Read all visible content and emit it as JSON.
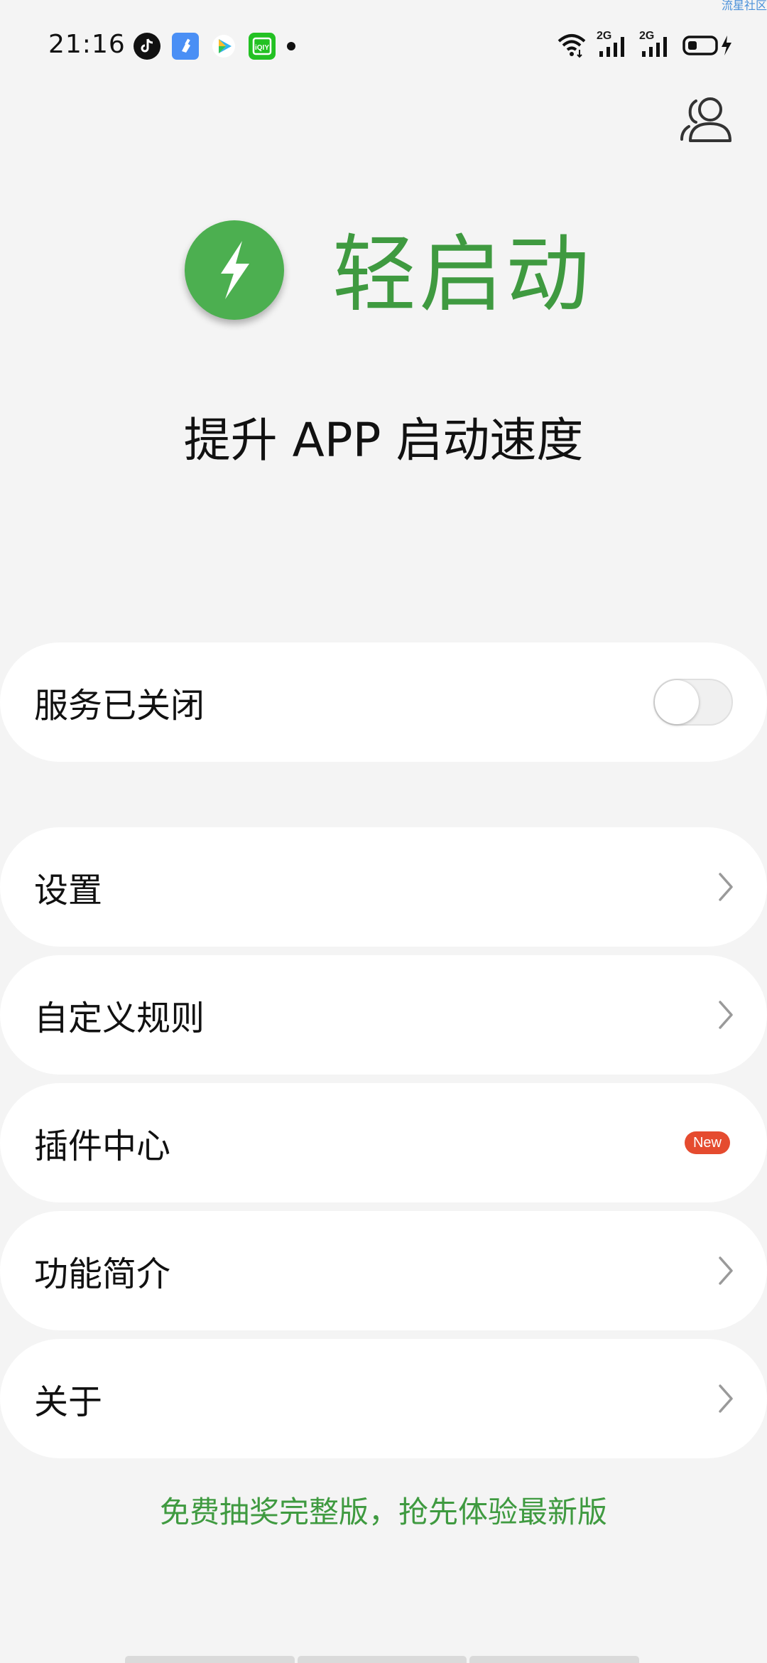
{
  "watermark": "流星社区",
  "status_bar": {
    "time": "21:16",
    "network_1": "2G",
    "network_2": "2G",
    "apps": [
      "tiktok-icon",
      "cleaner-icon",
      "video-play-icon",
      "iqiyi-icon"
    ]
  },
  "header": {
    "app_name": "轻启动",
    "slogan": "提升 APP 启动速度"
  },
  "service": {
    "label": "服务已关闭",
    "enabled": false
  },
  "menu": {
    "items": [
      {
        "label": "设置"
      },
      {
        "label": "自定义规则"
      },
      {
        "label": "插件中心",
        "badge": "New"
      },
      {
        "label": "功能简介"
      },
      {
        "label": "关于"
      }
    ]
  },
  "promo_text": "免费抽奖完整版，抢先体验最新版",
  "colors": {
    "brand_green": "#3f9a40",
    "logo_green": "#4caf50",
    "background": "#f4f4f4",
    "badge_red": "#e54b2f"
  }
}
